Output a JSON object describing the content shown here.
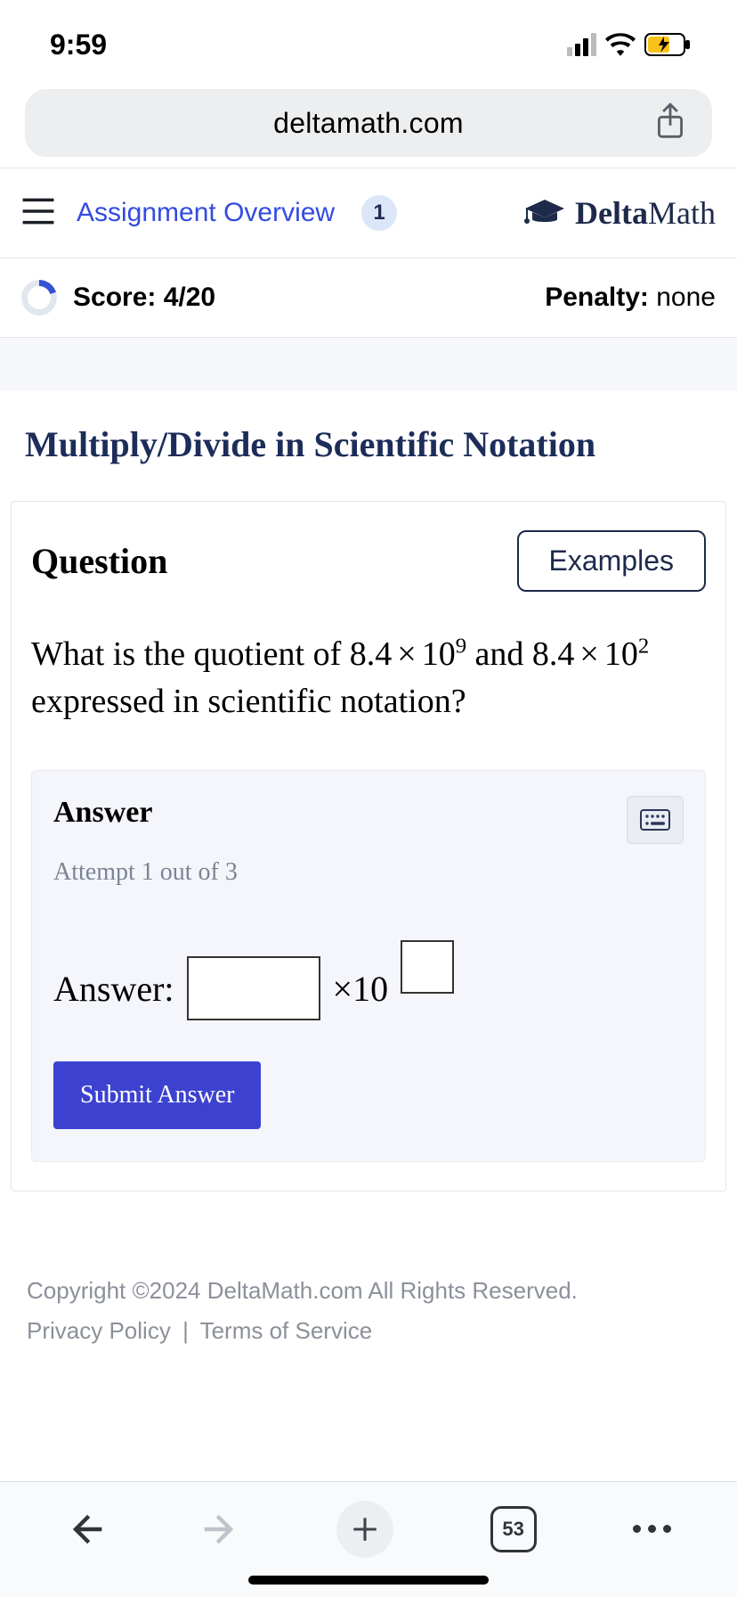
{
  "status": {
    "time": "9:59"
  },
  "browser": {
    "address": "deltamath.com",
    "tabs_count": "53"
  },
  "header": {
    "assignment_link": "Assignment Overview",
    "assignment_count": "1",
    "logo_brand": "Delta",
    "logo_suffix": "Math"
  },
  "score": {
    "label": "Score: 4/20",
    "penalty_label": "Penalty: ",
    "penalty_value": "none"
  },
  "page": {
    "title": "Multiply/Divide in Scientific Notation"
  },
  "question": {
    "heading": "Question",
    "examples_button": "Examples",
    "p1": "What is the quotient of 8.4",
    "p2": "10",
    "exp1": "9",
    "p3": " and ",
    "p4": "8.4",
    "exp2": "2",
    "p5": " expressed in scientific notation?",
    "times": "×"
  },
  "answer": {
    "title": "Answer",
    "attempt": "Attempt 1 out of 3",
    "label": "Answer:",
    "times10": "×10",
    "submit": "Submit Answer"
  },
  "footer": {
    "copyright": "Copyright ©2024 DeltaMath.com All Rights Reserved.",
    "privacy": "Privacy Policy",
    "sep": "|",
    "terms": "Terms of Service"
  }
}
